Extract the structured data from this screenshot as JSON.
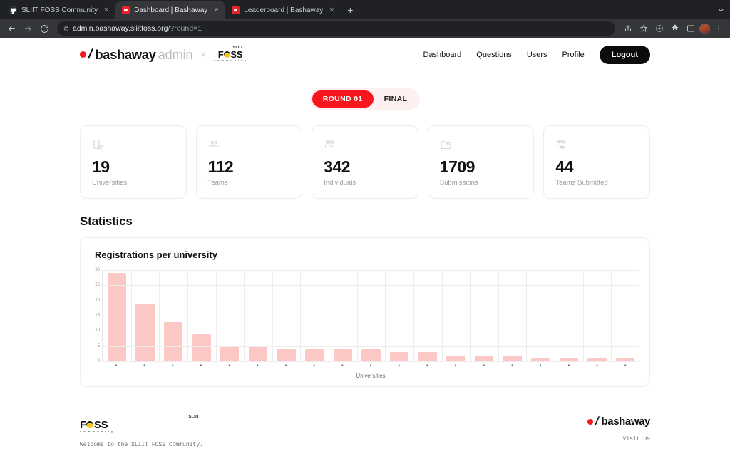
{
  "browser": {
    "tabs": [
      {
        "title": "SLIIT FOSS Community",
        "favicon": "github-icon",
        "active": false
      },
      {
        "title": "Dashboard | Bashaway",
        "favicon": "bashaway-icon",
        "active": true
      },
      {
        "title": "Leaderboard | Bashaway",
        "favicon": "bashaway-icon",
        "active": false
      }
    ],
    "new_tab_label": "+",
    "close_label": "×",
    "back_icon": "back-arrow-icon",
    "forward_icon": "forward-arrow-icon",
    "reload_icon": "reload-icon",
    "url_lock_icon": "lock-icon",
    "url_main": "admin.bashaway.sliitfoss.org",
    "url_query": "/?round=1",
    "toolbar_icons": [
      "share-icon",
      "bookmark-star-icon",
      "circle-icon",
      "extensions-puzzle-icon",
      "sidebar-panel-icon",
      "profile-avatar",
      "three-dot-menu-icon"
    ],
    "tabstrip_menu_icon": "chevron-down-icon"
  },
  "header": {
    "brand": {
      "dot": "●",
      "slash": "/",
      "name": "bashaway",
      "sub": "admin",
      "separator": "×"
    },
    "foss_logo": {
      "top": "SLIIT",
      "main_left": "F",
      "main_right": "SS",
      "bottom": "c o m m u n i t y"
    },
    "nav": [
      {
        "label": "Dashboard"
      },
      {
        "label": "Questions"
      },
      {
        "label": "Users"
      },
      {
        "label": "Profile"
      }
    ],
    "logout_label": "Logout"
  },
  "round_toggle": {
    "options": [
      {
        "label": "ROUND 01",
        "active": true
      },
      {
        "label": "FINAL",
        "active": false
      }
    ]
  },
  "stats": [
    {
      "value": "19",
      "label": "Universities",
      "icon": "university-building-icon"
    },
    {
      "value": "112",
      "label": "Teams",
      "icon": "teams-group-icon"
    },
    {
      "value": "342",
      "label": "Individuals",
      "icon": "individuals-people-icon"
    },
    {
      "value": "1709",
      "label": "Submissions",
      "icon": "submissions-folder-icon"
    },
    {
      "value": "44",
      "label": "Teams Submitted",
      "icon": "teams-submitted-icon"
    }
  ],
  "section": {
    "title": "Statistics"
  },
  "chart_data": {
    "type": "bar",
    "title": "Registrations per university",
    "xlabel": "Universities",
    "ylabel": "",
    "ylim": [
      0,
      30
    ],
    "yticks": [
      0,
      5,
      10,
      15,
      20,
      25,
      30
    ],
    "grid": true,
    "legend": false,
    "bar_color": "#fcc8c6",
    "categories": [
      "",
      "",
      "",
      "",
      "",
      "",
      "",
      "",
      "",
      "",
      "",
      "",
      "",
      "",
      "",
      "",
      "",
      "",
      ""
    ],
    "values": [
      29,
      19,
      13,
      9,
      5,
      5,
      4,
      4,
      4,
      4,
      3,
      3,
      2,
      2,
      2,
      1,
      1,
      1,
      1
    ],
    "tick_marker": "•"
  },
  "footer": {
    "welcome_text": "Welcome to the SLIIT FOSS Community.",
    "visit_text": "Visit Us",
    "foss_logo": {
      "top": "SLIIT",
      "main_left": "F",
      "main_right": "SS",
      "bottom": "c o m m u n i t y"
    },
    "brand": {
      "dot": "●",
      "slash": "/",
      "name": "bashaway"
    }
  },
  "colors": {
    "accent_red": "#f5161e",
    "bar_pink": "#fcc8c6",
    "ink": "#111111",
    "muted": "#9b9b9b"
  }
}
